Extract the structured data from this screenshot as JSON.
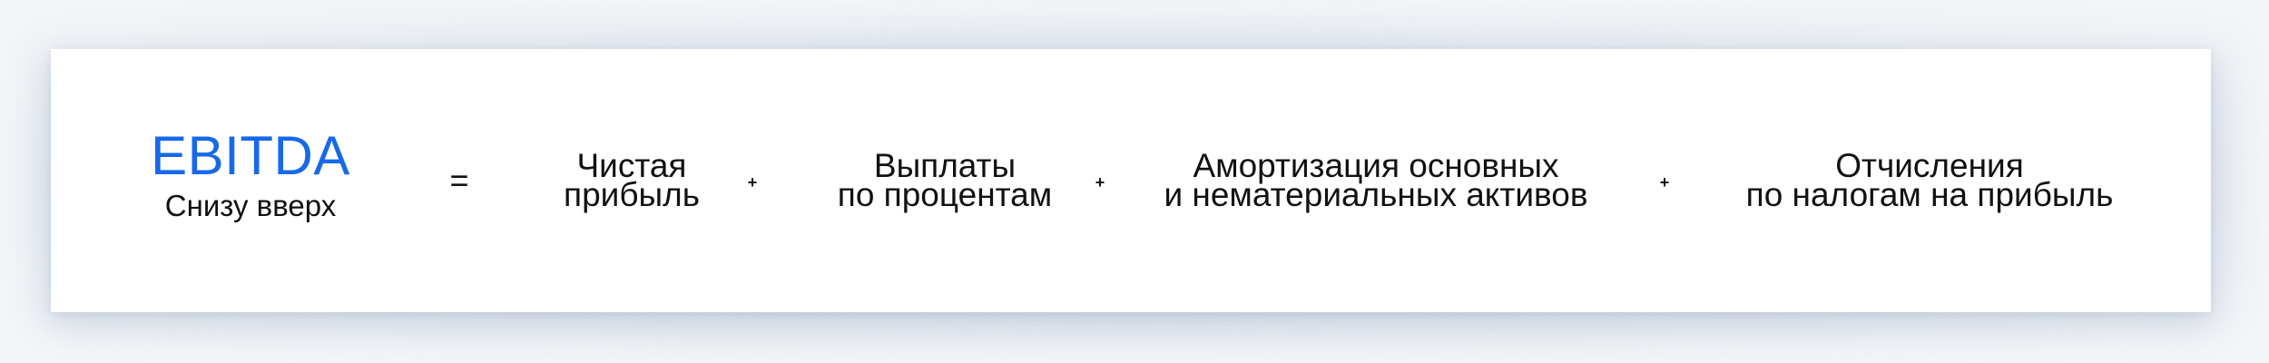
{
  "formula": {
    "left": {
      "title": "EBITDA",
      "subtitle": "Снизу вверх"
    },
    "equals": "=",
    "plus": "+",
    "terms": [
      {
        "line1": "Чистая",
        "line2": "прибыль"
      },
      {
        "line1": "Выплаты",
        "line2": "по процентам"
      },
      {
        "line1": "Амортизация основных",
        "line2": "и нематериальных активов"
      },
      {
        "line1": "Отчисления",
        "line2": "по налогам на прибыль"
      }
    ]
  },
  "colors": {
    "accent": "#1769e8",
    "text": "#111111",
    "background": "#ffffff"
  }
}
